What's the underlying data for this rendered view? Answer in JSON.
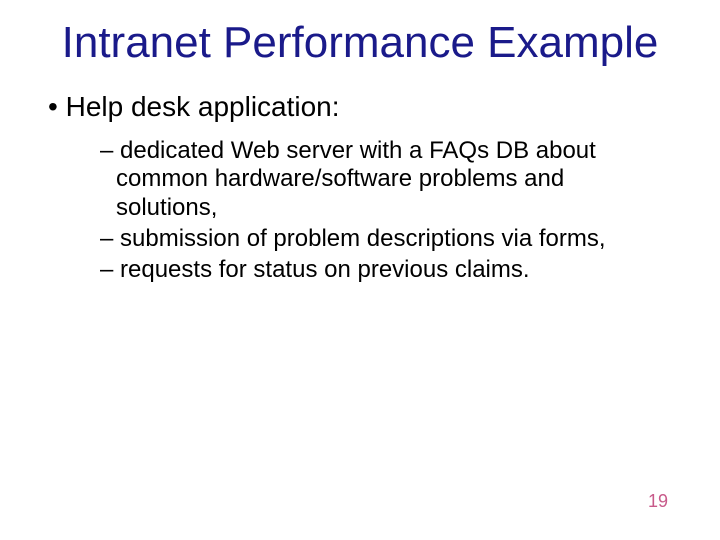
{
  "title": "Intranet Performance Example",
  "main_bullet": "Help desk application:",
  "sub_bullets": {
    "item1": "dedicated Web server with a FAQs DB about common hardware/software problems and solutions,",
    "item2": "submission of problem descriptions via forms,",
    "item3": "requests for status on previous claims."
  },
  "page_number": "19"
}
